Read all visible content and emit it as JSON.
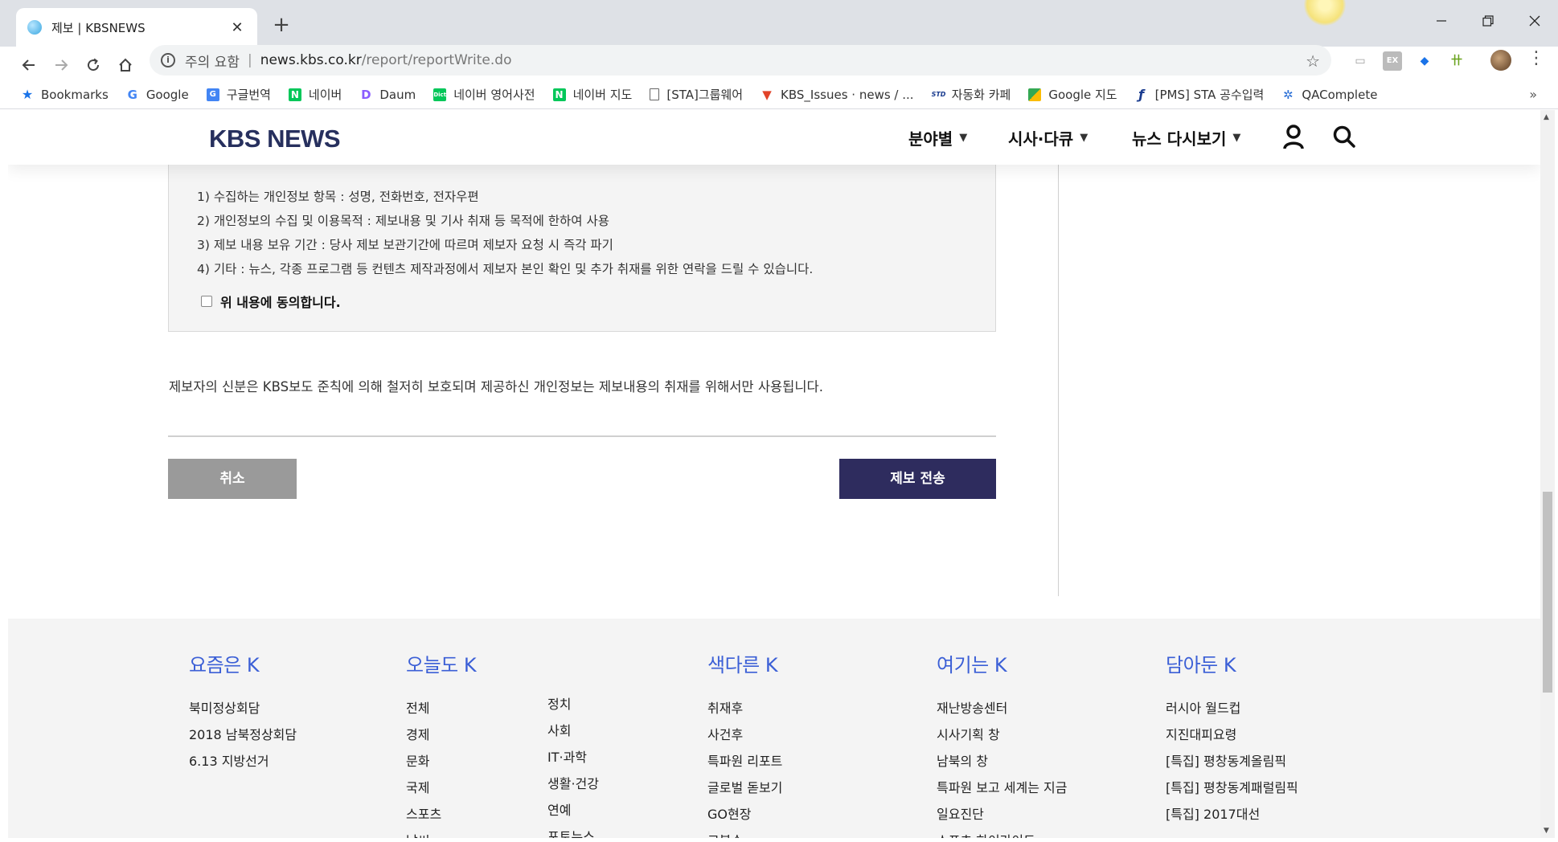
{
  "browser": {
    "tab_title": "제보 | KBSNEWS",
    "tab_close": "✕",
    "new_tab": "+",
    "security_label": "주의 요함",
    "url_separator": "|",
    "url_host": "news.kbs.co.kr",
    "url_path": "/report/reportWrite.do",
    "bookmarks": [
      {
        "label": "Bookmarks",
        "icon": "star-icon",
        "color": "#1a73e8"
      },
      {
        "label": "Google",
        "icon": "google-icon",
        "color": "#4285f4"
      },
      {
        "label": "구글번역",
        "icon": "translate-icon",
        "color": "#4285f4"
      },
      {
        "label": "네이버",
        "icon": "naver-icon",
        "color": "#03c75a"
      },
      {
        "label": "Daum",
        "icon": "daum-icon",
        "color": "#8a5cff"
      },
      {
        "label": "네이버 영어사전",
        "icon": "dict-icon",
        "color": "#03c75a"
      },
      {
        "label": "네이버 지도",
        "icon": "naver-icon",
        "color": "#03c75a"
      },
      {
        "label": "[STA]그룹웨어",
        "icon": "page-icon",
        "color": "#666666"
      },
      {
        "label": "KBS_Issues · news / ...",
        "icon": "gitlab-icon",
        "color": "#e24329"
      },
      {
        "label": "자동화 카페",
        "icon": "std-icon",
        "color": "#1a3c8f"
      },
      {
        "label": "Google 지도",
        "icon": "maps-icon",
        "color": "#34a853"
      },
      {
        "label": "[PMS] STA 공수입력",
        "icon": "pms-icon",
        "color": "#1a3c8f"
      },
      {
        "label": "QAComplete",
        "icon": "qacomplete-icon",
        "color": "#2a6fd6"
      }
    ],
    "bookmarks_more": "»"
  },
  "site": {
    "logo": "KBS NEWS",
    "nav": [
      {
        "label": "분야별"
      },
      {
        "label": "시사·다큐"
      },
      {
        "label": "뉴스 다시보기"
      }
    ]
  },
  "consent": {
    "items": [
      "1) 수집하는 개인정보 항목 : 성명, 전화번호, 전자우편",
      "2) 개인정보의 수집 및 이용목적 : 제보내용 및 기사 취재 등 목적에 한하여 사용",
      "3) 제보 내용 보유 기간 : 당사 제보 보관기간에 따르며 제보자 요청 시 즉각 파기",
      "4) 기타 : 뉴스, 각종 프로그램 등 컨텐츠 제작과정에서 제보자 본인 확인 및 추가 취재를 위한 연락을 드릴 수 있습니다."
    ],
    "agree_label": "위 내용에 동의합니다.",
    "agreed": false
  },
  "notice": "제보자의 신분은 KBS보도 준칙에 의해 철저히 보호되며 제공하신 개인정보는 제보내용의 취재를 위해서만 사용됩니다.",
  "buttons": {
    "cancel": "취소",
    "submit": "제보 전송"
  },
  "footer": {
    "columns": [
      {
        "heading": "요즘은 K",
        "links": [
          "북미정상회담",
          "2018 남북정상회담",
          "6.13 지방선거"
        ]
      },
      {
        "heading": "오늘도 K",
        "links": [
          "전체",
          "경제",
          "문화",
          "국제",
          "스포츠",
          "날씨"
        ]
      },
      {
        "heading": "",
        "links": [
          "정치",
          "사회",
          "IT·과학",
          "생활·건강",
          "연예",
          "포토뉴스"
        ]
      },
      {
        "heading": "색다른 K",
        "links": [
          "취재후",
          "사건후",
          "특파원 리포트",
          "글로벌 돋보기",
          "GO현장",
          "고봉수"
        ]
      },
      {
        "heading": "여기는 K",
        "links": [
          "재난방송센터",
          "시사기획 창",
          "남북의 창",
          "특파원 보고 세계는 지금",
          "일요진단",
          "스포츠 하이라이트"
        ]
      },
      {
        "heading": "담아둔 K",
        "links": [
          "러시아 월드컵",
          "지진대피요령",
          "[특집] 평창동계올림픽",
          "[특집] 평창동계패럴림픽",
          "[특집] 2017대선"
        ]
      }
    ]
  },
  "colors": {
    "brand_navy": "#27305e",
    "submit_bg": "#2e2c5e",
    "cancel_bg": "#9a9a9a",
    "footer_heading": "#3b5fd6"
  }
}
